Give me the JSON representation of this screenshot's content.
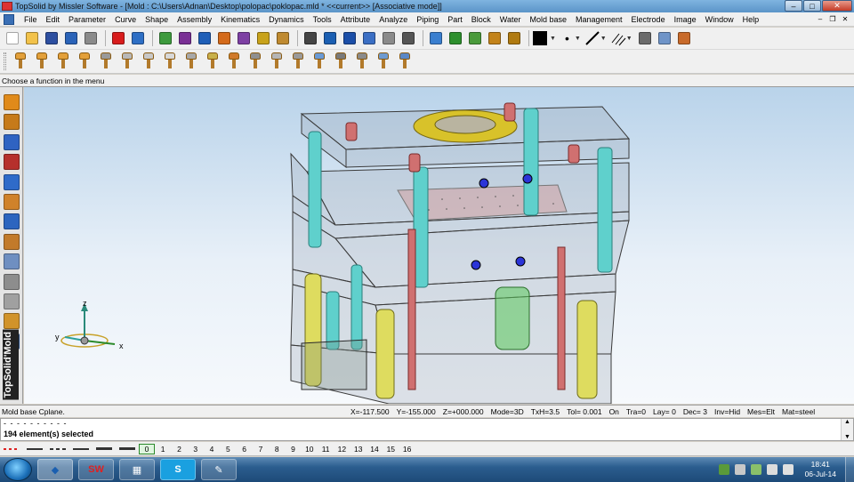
{
  "window": {
    "title": "TopSolid by Missler Software - [Mold : C:\\Users\\Adnan\\Desktop\\polopac\\poklopac.mld *  <<current>> [Associative mode]]",
    "buttons": {
      "minimize": "–",
      "maximize": "□",
      "close": "✕"
    }
  },
  "menu": {
    "items": [
      "File",
      "Edit",
      "Parameter",
      "Curve",
      "Shape",
      "Assembly",
      "Kinematics",
      "Dynamics",
      "Tools",
      "Attribute",
      "Analyze",
      "Piping",
      "Part",
      "Block",
      "Water",
      "Mold base",
      "Management",
      "Electrode",
      "Image",
      "Window",
      "Help"
    ],
    "mdi_controls": {
      "minimize": "–",
      "restore": "❐",
      "close": "✕"
    }
  },
  "toolbar1": {
    "icons": [
      {
        "name": "new-icon",
        "color": "#ffffff"
      },
      {
        "name": "open-icon",
        "color": "#f2c24a"
      },
      {
        "name": "save-icon",
        "color": "#2d4fa0"
      },
      {
        "name": "properties-icon",
        "color": "#2a63b8"
      },
      {
        "name": "print-icon",
        "color": "#8a8a8a"
      },
      {
        "name": "delete-icon",
        "color": "#d81c1c"
      },
      {
        "name": "undo-icon",
        "color": "#2e6fc5"
      },
      {
        "name": "update-icon",
        "color": "#3d9a3d"
      },
      {
        "name": "measure-icon",
        "color": "#7a2f95"
      },
      {
        "name": "parameters-icon",
        "color": "#1f5fb8"
      },
      {
        "name": "edit-icon",
        "color": "#d46a1a"
      },
      {
        "name": "group-icon",
        "color": "#7d3fa3"
      },
      {
        "name": "attribute-icon",
        "color": "#c8a21a"
      },
      {
        "name": "eraser-icon",
        "color": "#bf8a30"
      },
      {
        "name": "cut-icon",
        "color": "#444444"
      },
      {
        "name": "point-icon",
        "color": "#1b5fb2"
      },
      {
        "name": "axis-icon",
        "color": "#1c4fa8"
      },
      {
        "name": "shape-icon",
        "color": "#3b6fc4"
      },
      {
        "name": "hook-icon",
        "color": "#8a8a8a"
      },
      {
        "name": "tag-icon",
        "color": "#555555"
      },
      {
        "name": "zoom-icon",
        "color": "#3a7fcf"
      },
      {
        "name": "zoom-window-icon",
        "color": "#2d8f2d"
      },
      {
        "name": "image-icon",
        "color": "#4a9a3b"
      },
      {
        "name": "rotate-icon",
        "color": "#c3831a"
      },
      {
        "name": "pan-icon",
        "color": "#b07a10"
      }
    ],
    "color_swatch": "#000000",
    "extra_icons": [
      {
        "name": "camera-icon",
        "color": "#6b6b6b"
      },
      {
        "name": "render-icon",
        "color": "#6f94c8"
      },
      {
        "name": "view-icon",
        "color": "#c86a2a"
      }
    ]
  },
  "toolbar2": {
    "icons": [
      {
        "name": "screw-icon",
        "color": "#e3a03a"
      },
      {
        "name": "screw-icon",
        "color": "#e3a03a"
      },
      {
        "name": "screw-icon",
        "color": "#e3a03a"
      },
      {
        "name": "screw-icon",
        "color": "#e3a03a"
      },
      {
        "name": "cylinder-icon",
        "color": "#9a9a9a"
      },
      {
        "name": "cylinder-icon",
        "color": "#b8b8b8"
      },
      {
        "name": "cylinder-icon",
        "color": "#c8c8c8"
      },
      {
        "name": "cylinder-icon",
        "color": "#d8d8d8"
      },
      {
        "name": "ring-icon",
        "color": "#a8a8a8"
      },
      {
        "name": "bolt-icon",
        "color": "#c8b04a"
      },
      {
        "name": "link-icon",
        "color": "#d07a2a"
      },
      {
        "name": "part-icon",
        "color": "#8f8f8f"
      },
      {
        "name": "pin-icon",
        "color": "#b5b5b5"
      },
      {
        "name": "plug-icon",
        "color": "#9a9a9a"
      },
      {
        "name": "bulb-icon",
        "color": "#6a9ad5"
      },
      {
        "name": "spring-icon",
        "color": "#7a7a7a"
      },
      {
        "name": "spring-icon",
        "color": "#8a8a8a"
      },
      {
        "name": "clamp-icon",
        "color": "#6f9bd0"
      },
      {
        "name": "valve-icon",
        "color": "#5b88c6"
      }
    ]
  },
  "prompt": {
    "text": "Choose a function in the menu"
  },
  "left_toolbar": {
    "icons": [
      {
        "name": "sketch-icon",
        "color": "#e08a1a"
      },
      {
        "name": "curve-icon",
        "color": "#c67a1a"
      },
      {
        "name": "solid-icon",
        "color": "#2f63c2"
      },
      {
        "name": "surface-icon",
        "color": "#b6302c"
      },
      {
        "name": "shape-icon",
        "color": "#2f6bc9"
      },
      {
        "name": "assembly-icon",
        "color": "#d0822a"
      },
      {
        "name": "component-icon",
        "color": "#2c65bf"
      },
      {
        "name": "mold-icon",
        "color": "#c27a2a"
      },
      {
        "name": "plate-icon",
        "color": "#6f8fc1"
      },
      {
        "name": "ejector-icon",
        "color": "#8d8d8d"
      },
      {
        "name": "cooling-icon",
        "color": "#a0a0a0"
      },
      {
        "name": "screw-icon",
        "color": "#d1932a"
      },
      {
        "name": "analysis-icon",
        "color": "#2f5fa8"
      }
    ],
    "brand": "TopSolid'Mold"
  },
  "viewport": {
    "axis_labels": {
      "z": "z",
      "y": "y",
      "x": "x"
    }
  },
  "status": {
    "left": "Mold base Cplane.",
    "fields": [
      "X=-117.500",
      "Y=-155.000",
      "Z=+000.000",
      "Mode=3D",
      "TxH=3.5",
      "Tol= 0.001",
      "On",
      "Tra=0",
      "Lay= 0",
      "Dec= 3",
      "Inv=Hid",
      "Mes=Elt",
      "Mat=steel"
    ]
  },
  "messages": {
    "line1": "- - - - - - - - - -",
    "line2": "194 element(s) selected"
  },
  "layers": {
    "active": "0",
    "numbers": [
      "1",
      "2",
      "3",
      "4",
      "5",
      "6",
      "7",
      "8",
      "9",
      "10",
      "11",
      "12",
      "13",
      "14",
      "15",
      "16"
    ]
  },
  "taskbar": {
    "apps": [
      {
        "name": "topsolid-taskbar-icon",
        "label": ""
      },
      {
        "name": "solidworks-taskbar-icon",
        "label": "SW"
      },
      {
        "name": "calculator-taskbar-icon",
        "label": ""
      },
      {
        "name": "skype-taskbar-icon",
        "label": "S"
      },
      {
        "name": "paint-taskbar-icon",
        "label": ""
      }
    ],
    "clock_time": "18:41",
    "clock_date": "06-Jul-14"
  }
}
